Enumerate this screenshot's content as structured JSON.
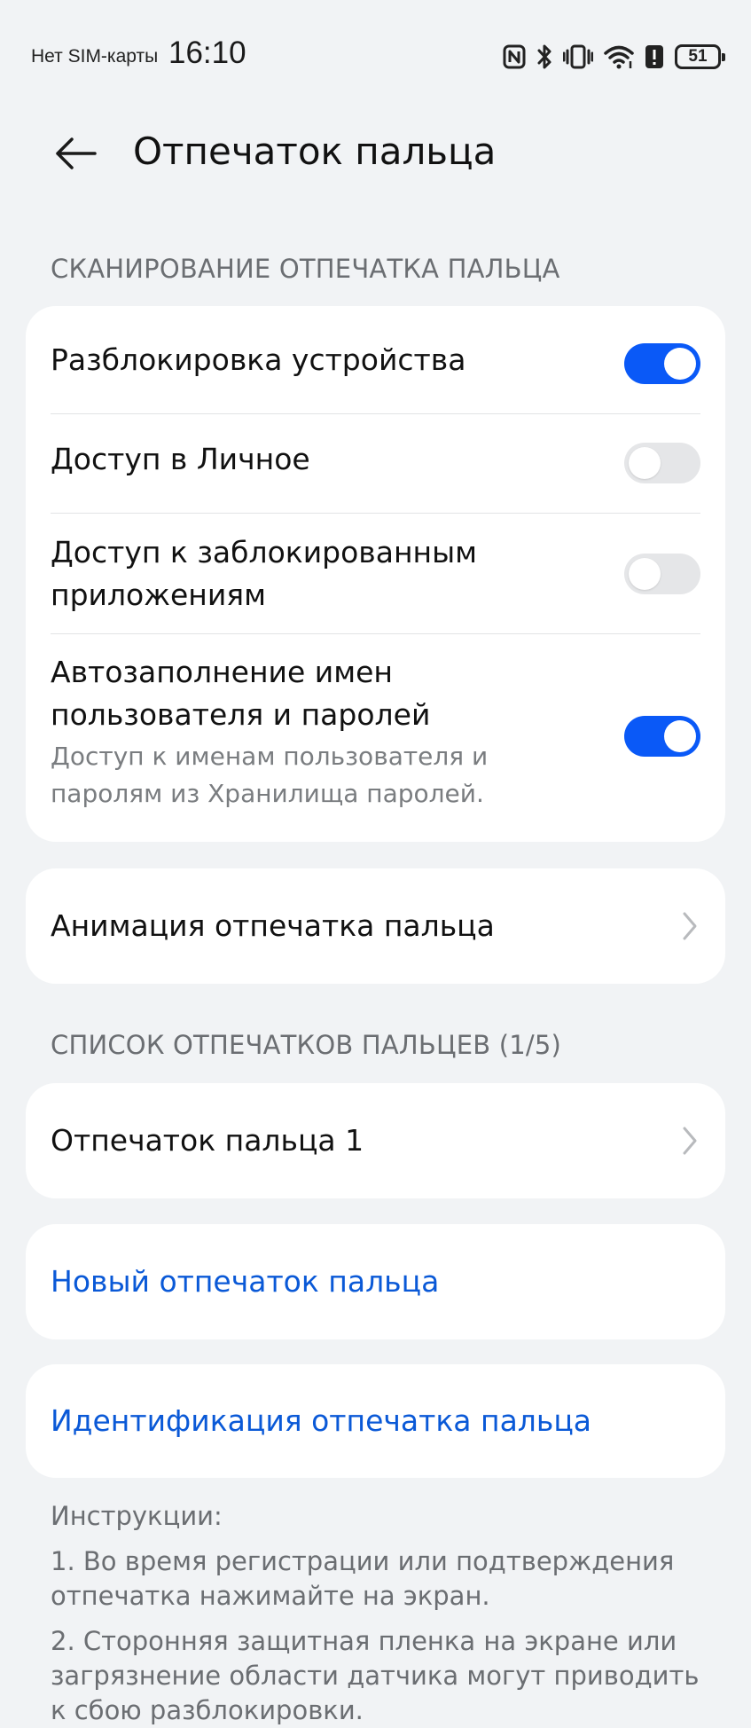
{
  "status_bar": {
    "sim": "Нет SIM-карты",
    "time": "16:10",
    "battery": "51"
  },
  "header": {
    "title": "Отпечаток пальца"
  },
  "scan_section": {
    "title": "СКАНИРОВАНИЕ ОТПЕЧАТКА ПАЛЬЦА",
    "items": [
      {
        "label": "Разблокировка устройства",
        "enabled": true
      },
      {
        "label": "Доступ в Личное",
        "enabled": false
      },
      {
        "label_line1": "Доступ к заблокированным",
        "label_line2": "приложениям",
        "enabled": false
      },
      {
        "label_line1": "Автозаполнение имен",
        "label_line2": "пользователя и паролей",
        "sub_line1": "Доступ к именам пользователя и",
        "sub_line2": "паролям из Хранилища паролей.",
        "enabled": true
      }
    ]
  },
  "animation": {
    "label": "Анимация отпечатка пальца"
  },
  "list_section": {
    "title": "СПИСОК ОТПЕЧАТКОВ ПАЛЬЦЕВ (1/5)",
    "items": [
      {
        "label": "Отпечаток пальца 1"
      }
    ]
  },
  "actions": {
    "new_fingerprint": "Новый отпечаток пальца",
    "identify": "Идентификация отпечатка пальца"
  },
  "instructions": {
    "title": "Инструкции:",
    "step1_line1": "1. Во время регистрации или подтверждения",
    "step1_line2": "отпечатка нажимайте на экран.",
    "step2_line1": "2. Сторонняя защитная пленка на экране или",
    "step2_line2": "загрязнение области датчика могут приводить",
    "step2_line3": "к сбою разблокировки."
  },
  "colors": {
    "accent": "#0a59f7",
    "link": "#0a59d7",
    "background": "#f1f3f5"
  }
}
